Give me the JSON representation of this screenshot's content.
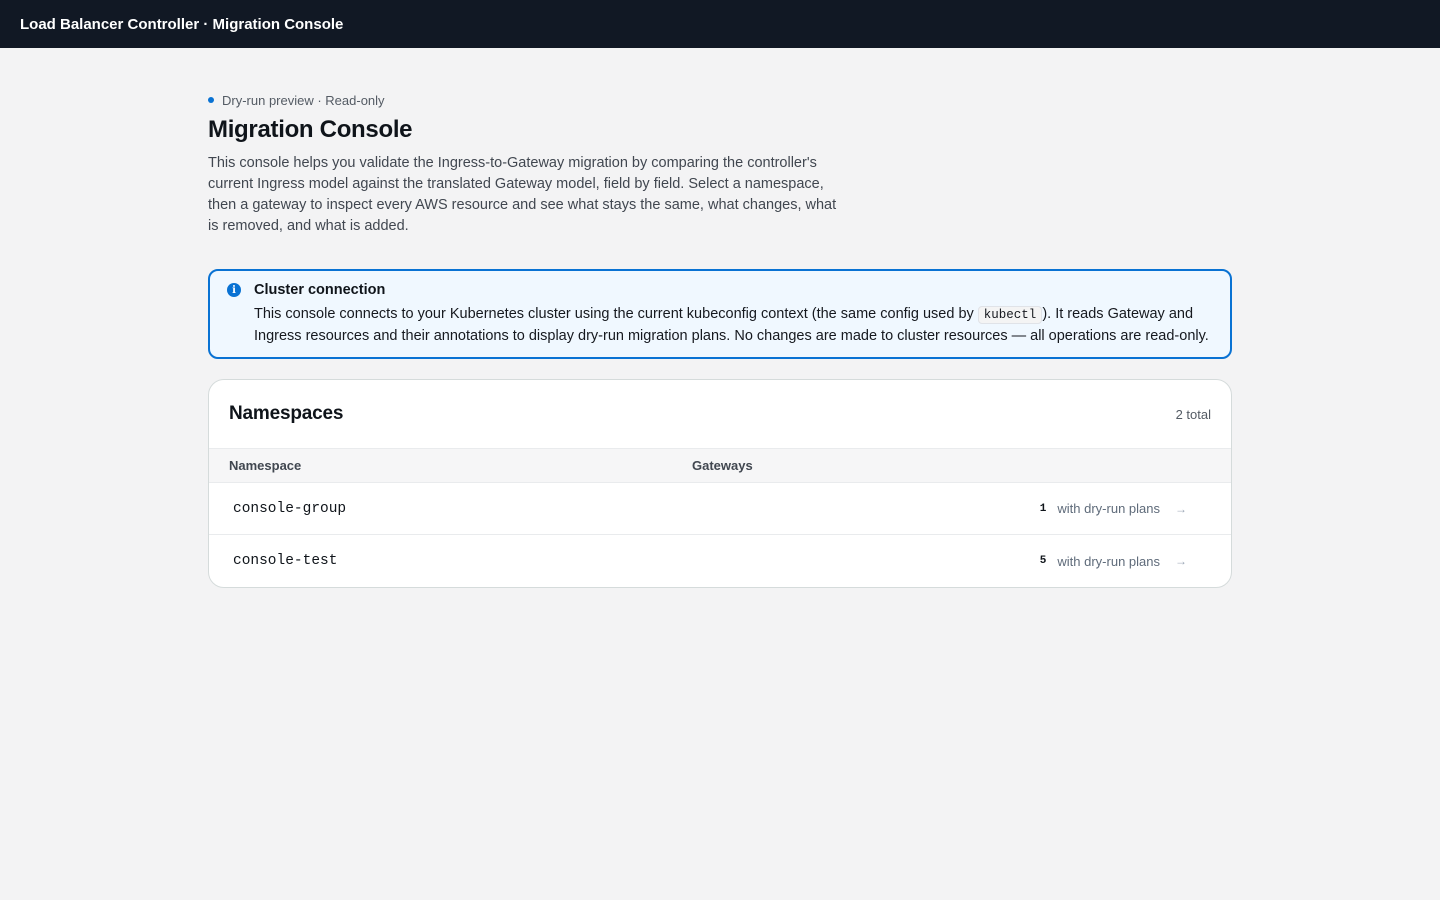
{
  "app": {
    "title": "Load Balancer Controller · Migration Console"
  },
  "header": {
    "eyebrow": "Dry-run preview · Read-only",
    "title": "Migration Console",
    "description": "This console helps you validate the Ingress-to-Gateway migration by comparing the controller's current Ingress model against the translated Gateway model, field by field. Select a namespace, then a gateway to inspect every AWS resource and see what stays the same, what changes, what is removed, and what is added."
  },
  "info_alert": {
    "icon": "info-icon",
    "title": "Cluster connection",
    "body_before": "This console connects to your Kubernetes cluster using the current kubeconfig context (the same config used by ",
    "code": "kubectl",
    "body_after": "). It reads Gateway and Ingress resources and their annotations to display dry-run migration plans. No changes are made to cluster resources — all operations are read-only."
  },
  "namespaces": {
    "title": "Namespaces",
    "total": "2 total",
    "columns": [
      "Namespace",
      "Gateways"
    ],
    "rows": [
      {
        "name": "console-group",
        "count": "1",
        "label": "with dry-run plans",
        "arrow": "→"
      },
      {
        "name": "console-test",
        "count": "5",
        "label": "with dry-run plans",
        "arrow": "→"
      }
    ]
  },
  "colors": {
    "topbar": "#111824",
    "accent": "#0972d3",
    "background": "#f3f3f4"
  }
}
